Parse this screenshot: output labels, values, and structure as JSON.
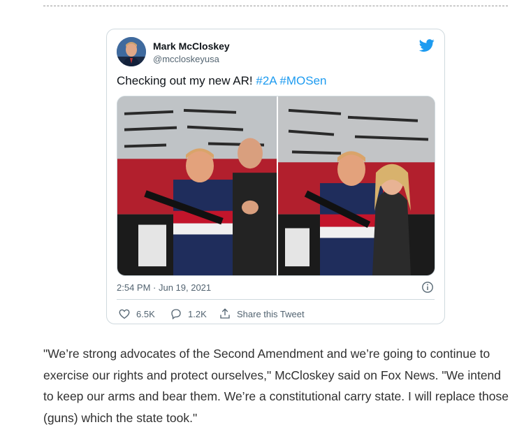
{
  "tweet": {
    "author_name": "Mark McCloskey",
    "author_handle": "@mccloskeyusa",
    "text": "Checking out my new AR! ",
    "hashtags": [
      "#2A",
      "#MOSen"
    ],
    "timestamp": "2:54 PM · Jun 19, 2021",
    "actions": {
      "likes": "6.5K",
      "replies": "1.2K",
      "share_label": "Share this Tweet"
    },
    "icons": [
      "avatar",
      "twitter-bird-icon",
      "info-icon",
      "heart-icon",
      "reply-icon",
      "share-icon"
    ]
  },
  "article": {
    "paragraph": "\"We’re strong advocates of the Second Amendment and we’re going to continue to exercise our rights and protect ourselves,\" McCloskey said on Fox News. \"We intend to keep our arms and bear them. We’re a constitutional carry state. I will replace those (guns) which the state took.\""
  },
  "colors": {
    "accent": "#1d9bf0",
    "border": "#cfd9de",
    "muted_text": "#536471",
    "article_text": "#303030"
  }
}
